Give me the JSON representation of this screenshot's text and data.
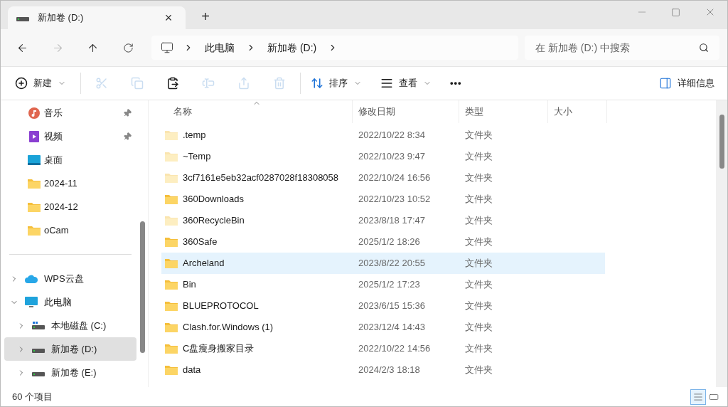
{
  "tab": {
    "title": "新加卷 (D:)",
    "close": "×",
    "new_tab": "+"
  },
  "address": {
    "crumbs": [
      "此电脑",
      "新加卷 (D:)"
    ]
  },
  "search": {
    "placeholder": "在 新加卷 (D:) 中搜索"
  },
  "toolbar": [
    {
      "kind": "new",
      "label": "新建",
      "disabled": false
    },
    {
      "kind": "cut",
      "disabled": true
    },
    {
      "kind": "copy",
      "disabled": true
    },
    {
      "kind": "paste",
      "disabled": false
    },
    {
      "kind": "rename",
      "disabled": true
    },
    {
      "kind": "share",
      "disabled": true
    },
    {
      "kind": "delete",
      "disabled": true
    },
    {
      "kind": "sort",
      "label": "排序",
      "disabled": false
    },
    {
      "kind": "view",
      "label": "查看",
      "disabled": false
    },
    {
      "kind": "more",
      "label": "•••",
      "disabled": false
    }
  ],
  "details_button": "详细信息",
  "sidebar": {
    "quick": [
      {
        "kind": "music",
        "label": "音乐",
        "pinned": true
      },
      {
        "kind": "video",
        "label": "视频",
        "pinned": true
      },
      {
        "kind": "desktop",
        "label": "桌面",
        "pinned": false
      },
      {
        "kind": "folder",
        "label": "2024-11",
        "pinned": false
      },
      {
        "kind": "folder",
        "label": "2024-12",
        "pinned": false
      },
      {
        "kind": "folder",
        "label": "oCam",
        "pinned": false
      }
    ],
    "tree": [
      {
        "kind": "cloud",
        "label": "WPS云盘",
        "expanded": false,
        "selected": false
      },
      {
        "kind": "pc",
        "label": "此电脑",
        "expanded": true,
        "selected": false,
        "children": [
          {
            "kind": "system-drive",
            "label": "本地磁盘 (C:)",
            "expanded": false,
            "selected": false
          },
          {
            "kind": "drive",
            "label": "新加卷 (D:)",
            "expanded": false,
            "selected": true
          },
          {
            "kind": "drive",
            "label": "新加卷 (E:)",
            "expanded": false,
            "selected": false
          }
        ]
      }
    ]
  },
  "table": {
    "columns": [
      {
        "label": "名称",
        "sorted": true
      },
      {
        "label": "修改日期",
        "sorted": false
      },
      {
        "label": "类型",
        "sorted": false
      },
      {
        "label": "大小",
        "sorted": false
      }
    ],
    "rows": [
      {
        "name": ".temp",
        "date": "2022/10/22 8:34",
        "type": "文件夹",
        "hidden": true,
        "selected": false
      },
      {
        "name": "~Temp",
        "date": "2022/10/23 9:47",
        "type": "文件夹",
        "hidden": true,
        "selected": false
      },
      {
        "name": "3cf7161e5eb32acf0287028f18308058",
        "date": "2022/10/24 16:56",
        "type": "文件夹",
        "hidden": true,
        "selected": false
      },
      {
        "name": "360Downloads",
        "date": "2022/10/23 10:52",
        "type": "文件夹",
        "hidden": false,
        "selected": false
      },
      {
        "name": "360RecycleBin",
        "date": "2023/8/18 17:47",
        "type": "文件夹",
        "hidden": true,
        "selected": false
      },
      {
        "name": "360Safe",
        "date": "2025/1/2 18:26",
        "type": "文件夹",
        "hidden": false,
        "selected": false
      },
      {
        "name": "Archeland",
        "date": "2023/8/22 20:55",
        "type": "文件夹",
        "hidden": false,
        "selected": true
      },
      {
        "name": "Bin",
        "date": "2025/1/2 17:23",
        "type": "文件夹",
        "hidden": false,
        "selected": false
      },
      {
        "name": "BLUEPROTOCOL",
        "date": "2023/6/15 15:36",
        "type": "文件夹",
        "hidden": false,
        "selected": false
      },
      {
        "name": "Clash.for.Windows (1)",
        "date": "2023/12/4 14:43",
        "type": "文件夹",
        "hidden": false,
        "selected": false
      },
      {
        "name": "C盘瘦身搬家目录",
        "date": "2022/10/22 14:56",
        "type": "文件夹",
        "hidden": false,
        "selected": false
      },
      {
        "name": "data",
        "date": "2024/2/3 18:18",
        "type": "文件夹",
        "hidden": false,
        "selected": false
      }
    ]
  },
  "status_bar": {
    "count": "60 个项目",
    "views": [
      {
        "kind": "details",
        "selected": true
      },
      {
        "kind": "tiles",
        "selected": false
      }
    ]
  }
}
